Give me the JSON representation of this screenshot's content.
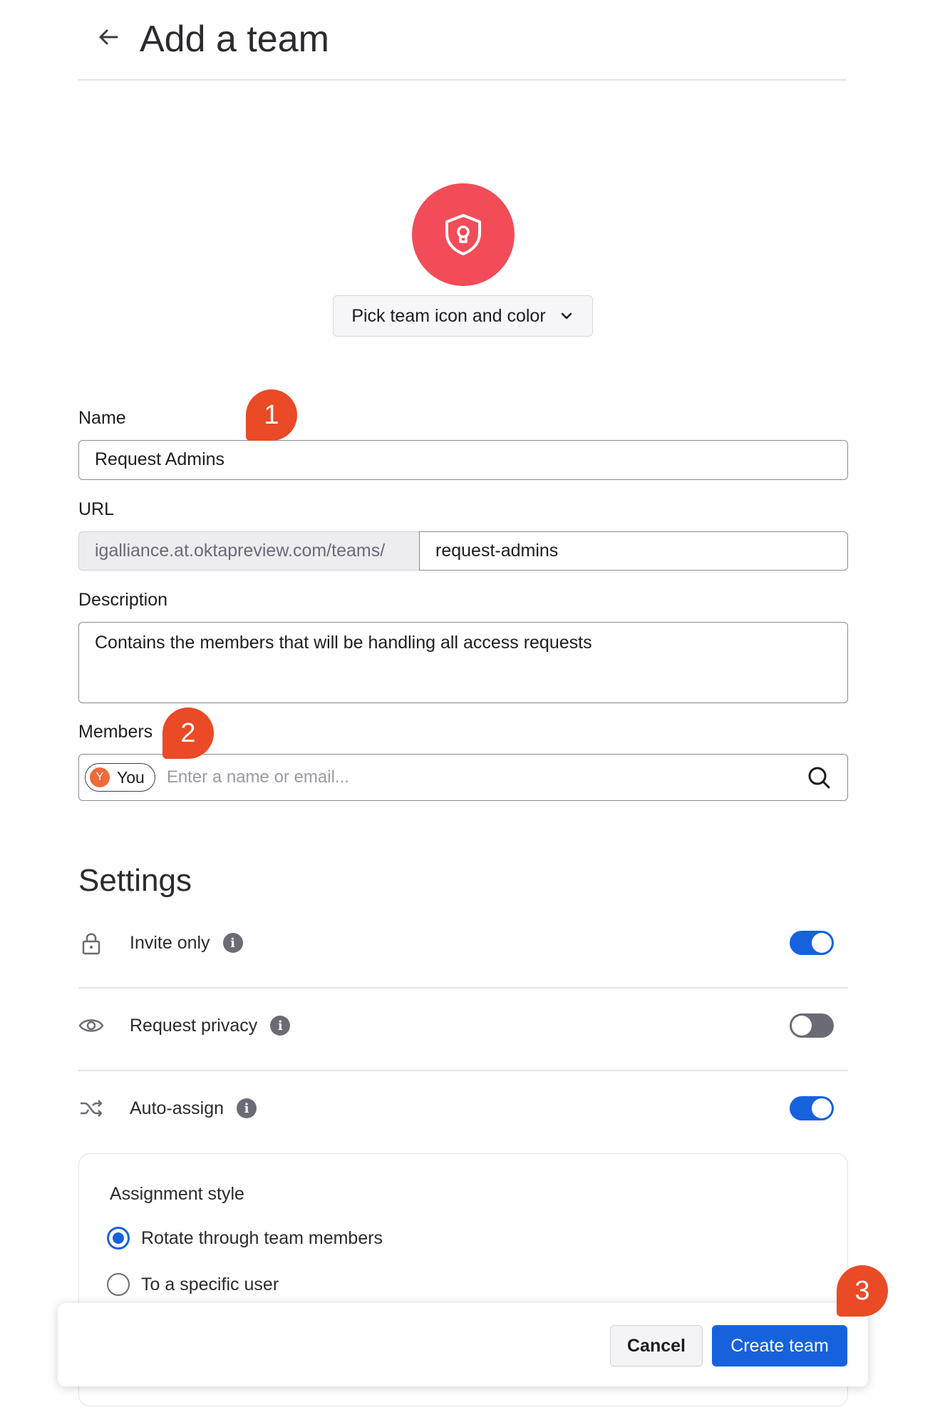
{
  "header": {
    "title": "Add a team",
    "back_icon": "arrow-left-icon"
  },
  "team_icon": {
    "icon": "shield-lock-icon",
    "color": "#f24c59",
    "picker_label": "Pick team icon and color"
  },
  "form": {
    "name_label": "Name",
    "name_value": "Request Admins",
    "url_label": "URL",
    "url_prefix": "igalliance.at.oktapreview.com/teams/",
    "url_value": "request-admins",
    "description_label": "Description",
    "description_value": "Contains the members that will be handling all access requests",
    "members_label": "Members",
    "members_chip_initial": "Y",
    "members_chip_label": "You",
    "members_placeholder": "Enter a name or email..."
  },
  "settings": {
    "title": "Settings",
    "rows": [
      {
        "label": "Invite only",
        "icon": "lock-icon",
        "enabled": true
      },
      {
        "label": "Request privacy",
        "icon": "eye-icon",
        "enabled": false
      },
      {
        "label": "Auto-assign",
        "icon": "shuffle-icon",
        "enabled": true
      }
    ],
    "assignment": {
      "title": "Assignment style",
      "options": [
        {
          "label": "Rotate through team members",
          "selected": true
        },
        {
          "label": "To a specific user",
          "selected": false
        }
      ]
    }
  },
  "footer": {
    "cancel_label": "Cancel",
    "create_label": "Create team"
  },
  "markers": [
    "1",
    "2",
    "3"
  ],
  "colors": {
    "primary": "#1662dd",
    "marker": "#ea4a25",
    "accent_red": "#f24c59"
  }
}
